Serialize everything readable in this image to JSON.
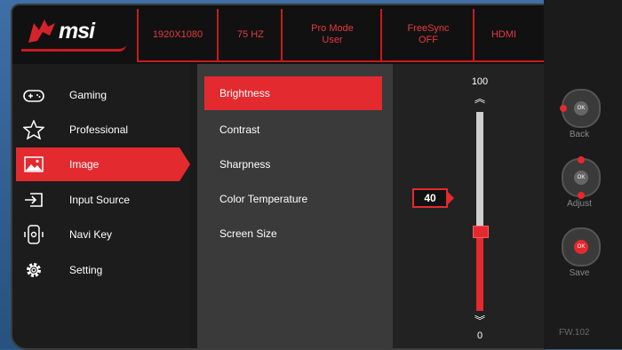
{
  "brand": {
    "logo_text": "msi"
  },
  "status_bar": [
    {
      "text": "1920X1080"
    },
    {
      "text": "75 HZ"
    },
    {
      "text": "Pro Mode\nUser"
    },
    {
      "text": "FreeSync\nOFF"
    },
    {
      "text": "HDMI"
    }
  ],
  "main_menu": [
    {
      "label": "Gaming",
      "icon": "gamepad-icon",
      "active": false
    },
    {
      "label": "Professional",
      "icon": "star-icon",
      "active": false
    },
    {
      "label": "Image",
      "icon": "image-icon",
      "active": true
    },
    {
      "label": "Input Source",
      "icon": "input-source-icon",
      "active": false
    },
    {
      "label": "Navi Key",
      "icon": "navi-key-icon",
      "active": false
    },
    {
      "label": "Setting",
      "icon": "gear-icon",
      "active": false
    }
  ],
  "sub_menu": [
    {
      "label": "Brightness",
      "active": true
    },
    {
      "label": "Contrast",
      "active": false
    },
    {
      "label": "Sharpness",
      "active": false
    },
    {
      "label": "Color Temperature",
      "active": false
    },
    {
      "label": "Screen Size",
      "active": false
    }
  ],
  "slider": {
    "max_label": "100",
    "min_label": "0",
    "value": 40,
    "value_label": "40"
  },
  "hardware_keys": [
    {
      "label": "Back",
      "icon": "back-key-icon",
      "center": "OK"
    },
    {
      "label": "Adjust",
      "icon": "adjust-key-icon",
      "center": "OK"
    },
    {
      "label": "Save",
      "icon": "save-key-icon",
      "center": "OK"
    }
  ],
  "firmware": "FW.102",
  "colors": {
    "accent": "#e32a2f",
    "panel": "#1a1a1a"
  }
}
